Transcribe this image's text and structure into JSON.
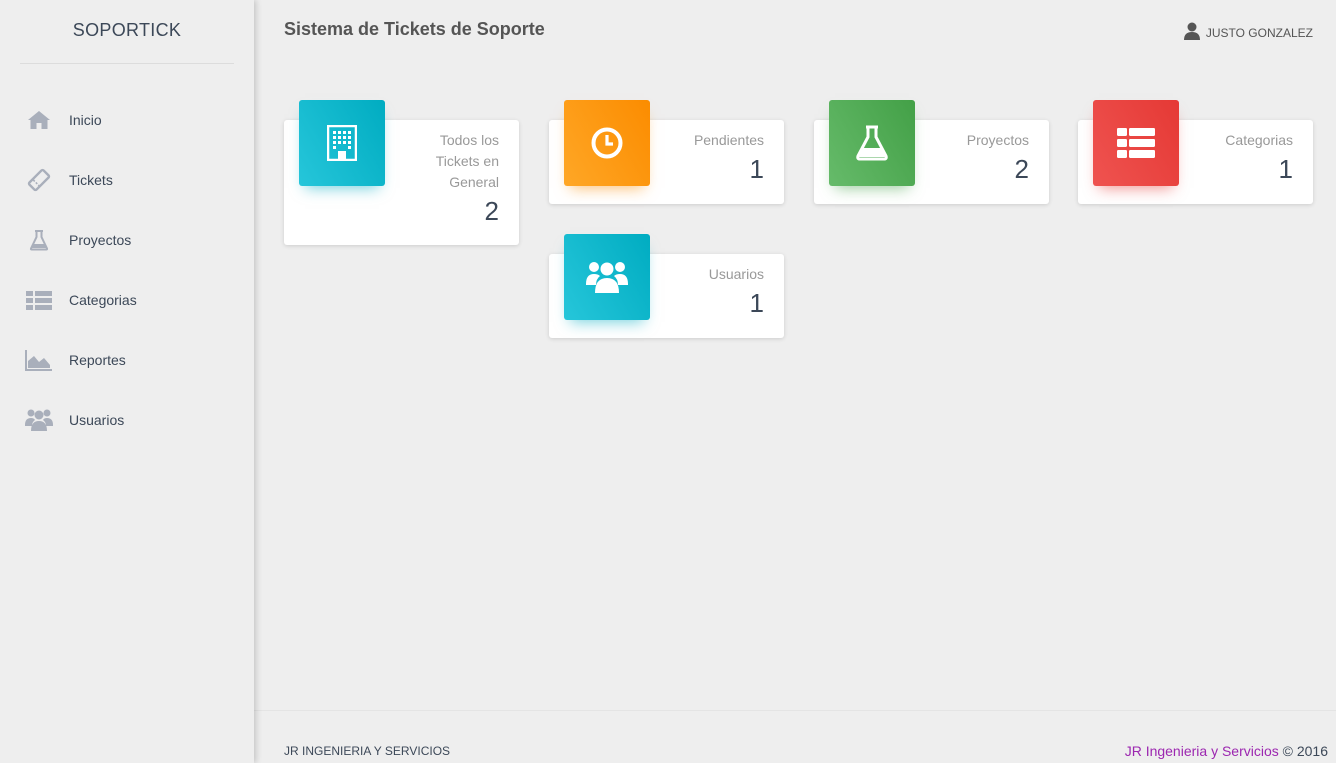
{
  "sidebar": {
    "brand": "SOPORTICK",
    "items": [
      {
        "label": "Inicio",
        "icon": "home-icon"
      },
      {
        "label": "Tickets",
        "icon": "ticket-icon"
      },
      {
        "label": "Proyectos",
        "icon": "flask-icon"
      },
      {
        "label": "Categorias",
        "icon": "list-icon"
      },
      {
        "label": "Reportes",
        "icon": "area-chart-icon"
      },
      {
        "label": "Usuarios",
        "icon": "users-icon"
      }
    ]
  },
  "header": {
    "title": "Sistema de Tickets de Soporte",
    "user": "JUSTO GONZALEZ"
  },
  "cards": [
    {
      "category_lines": [
        "Todos los",
        "Tickets en",
        "General"
      ],
      "value": "2",
      "icon": "building-icon",
      "color": "#00acc1"
    },
    {
      "category_lines": [
        "Pendientes"
      ],
      "value": "1",
      "icon": "clock-icon",
      "color": "#fb8c00"
    },
    {
      "category_lines": [
        "Proyectos"
      ],
      "value": "2",
      "icon": "flask-icon",
      "color": "#43a047"
    },
    {
      "category_lines": [
        "Categorias"
      ],
      "value": "1",
      "icon": "list-icon",
      "color": "#e53935"
    },
    {
      "category_lines": [
        "Usuarios"
      ],
      "value": "1",
      "icon": "users-icon",
      "color": "#00acc1"
    }
  ],
  "footer": {
    "left": "JR INGENIERIA Y SERVICIOS",
    "link": "JR Ingenieria y Servicios",
    "copyright": "© 2016"
  }
}
